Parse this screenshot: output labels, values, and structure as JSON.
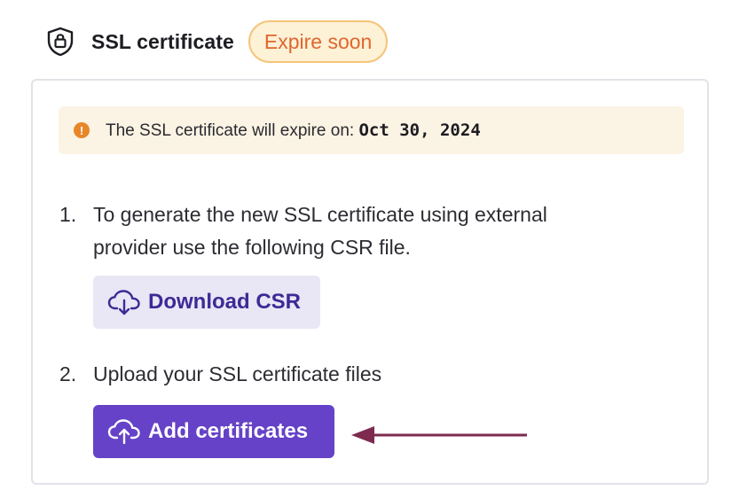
{
  "header": {
    "icon": "shield-lock-icon",
    "title": "SSL certificate",
    "badge": "Expire soon"
  },
  "alert": {
    "icon": "exclamation-circle-icon",
    "text": "The SSL certificate will expire on:",
    "date": "Oct 30, 2024"
  },
  "steps": [
    {
      "number": "1.",
      "line1": "To generate the new SSL certificate using external",
      "line2": "provider use the following CSR file.",
      "button": {
        "icon": "cloud-download-icon",
        "label": "Download CSR"
      }
    },
    {
      "number": "2.",
      "line1": "Upload your SSL certificate files",
      "button": {
        "icon": "cloud-upload-icon",
        "label": "Add certificates"
      }
    }
  ],
  "annotation": {
    "icon": "arrow-left-icon"
  },
  "colors": {
    "badge_text": "#e0662e",
    "badge_border": "#f4c57a",
    "badge_bg": "#fdf1d6",
    "alert_bg": "#fbf3e3",
    "alert_icon": "#e8862a",
    "primary": "#6542c7",
    "secondary_bg": "#e9e6f5",
    "secondary_text": "#3d2a96",
    "arrow": "#7e2a4f"
  }
}
